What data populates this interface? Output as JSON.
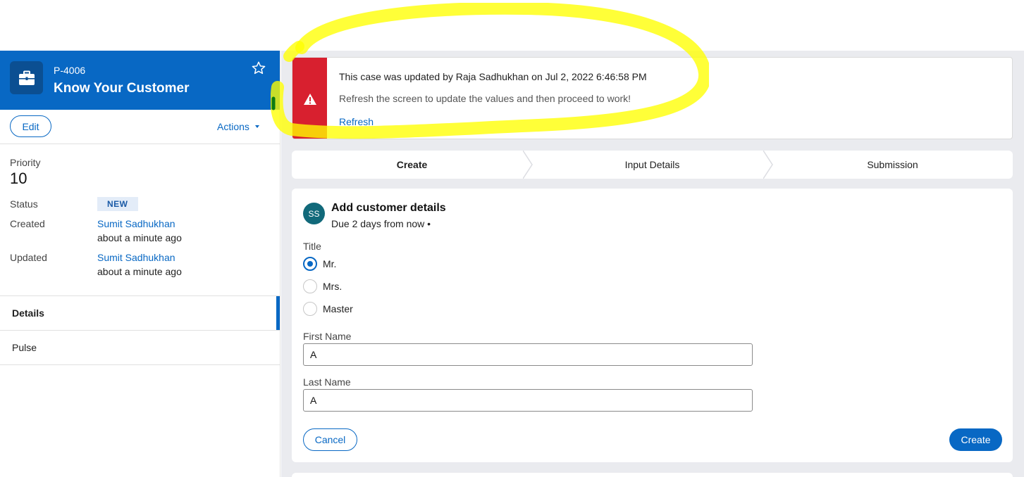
{
  "case": {
    "id": "P-4006",
    "title": "Know Your Customer",
    "edit_label": "Edit",
    "actions_label": "Actions"
  },
  "summary": {
    "priority_label": "Priority",
    "priority_value": "10",
    "status_label": "Status",
    "status_value": "NEW",
    "created_label": "Created",
    "created_by": "Sumit Sadhukhan",
    "created_time": "about a minute ago",
    "updated_label": "Updated",
    "updated_by": "Sumit Sadhukhan",
    "updated_time": "about a minute ago"
  },
  "tabs": [
    {
      "label": "Details",
      "active": true
    },
    {
      "label": "Pulse",
      "active": false
    }
  ],
  "banner": {
    "title": "This case was updated by Raja Sadhukhan on Jul 2, 2022 6:46:58 PM",
    "message": "Refresh the screen to update the values and then proceed to work!",
    "link": "Refresh"
  },
  "stages": [
    {
      "label": "Create",
      "current": true
    },
    {
      "label": "Input Details",
      "current": false
    },
    {
      "label": "Submission",
      "current": false
    }
  ],
  "task": {
    "avatar_initials": "SS",
    "title": "Add customer details",
    "due": "Due 2 days from now  •",
    "title_field_label": "Title",
    "title_options": [
      {
        "label": "Mr.",
        "selected": true
      },
      {
        "label": "Mrs.",
        "selected": false
      },
      {
        "label": "Master",
        "selected": false
      }
    ],
    "first_name_label": "First Name",
    "first_name_value": "A",
    "last_name_label": "Last Name",
    "last_name_value": "A",
    "cancel_label": "Cancel",
    "create_label": "Create"
  },
  "colors": {
    "brand": "#0868c4",
    "alert": "#d8202f",
    "highlight": "#ffff00"
  }
}
